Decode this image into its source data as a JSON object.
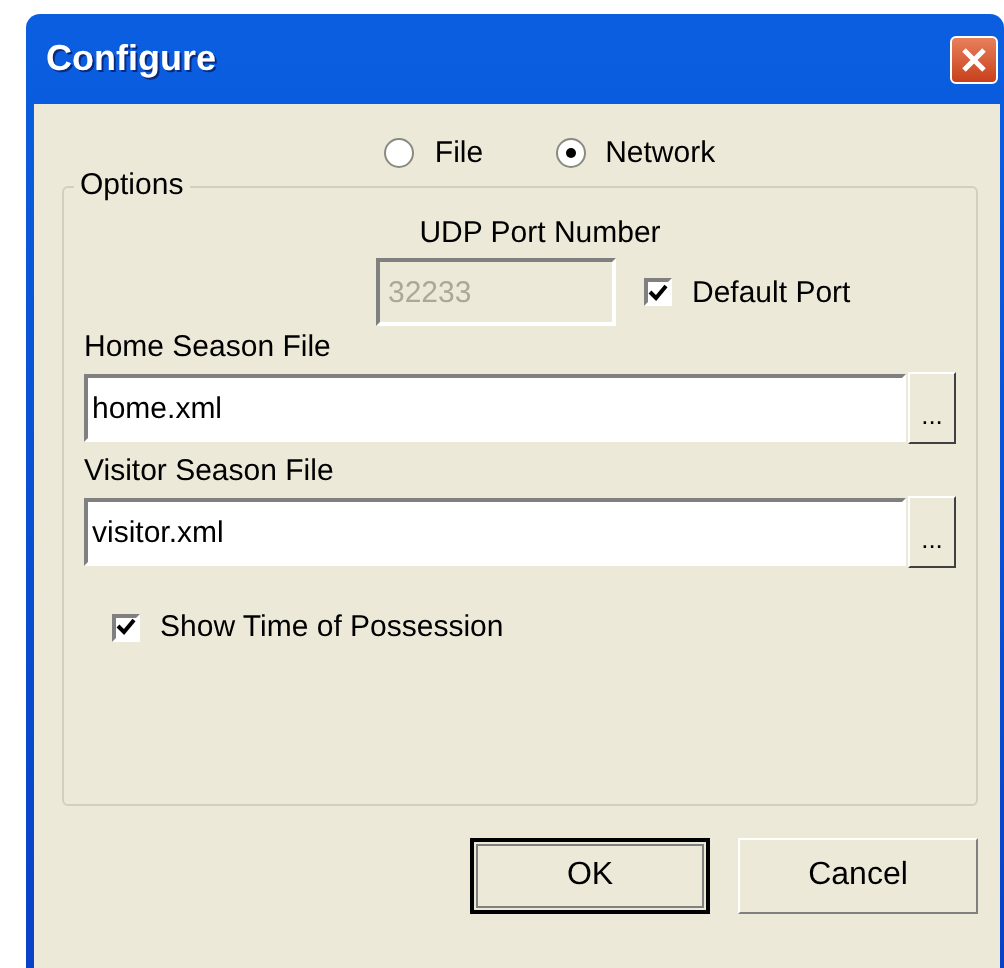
{
  "window": {
    "title": "Configure"
  },
  "mode": [
    {
      "label": "File",
      "selected": false
    },
    {
      "label": "Network",
      "selected": true
    }
  ],
  "options": {
    "title": "Options",
    "udp_port": {
      "label": "UDP Port Number",
      "value": "32233",
      "disabled": true
    },
    "default_port": {
      "label": "Default Port",
      "checked": true
    },
    "files": [
      {
        "label": "Home Season File",
        "value": "home.xml",
        "browse": "..."
      },
      {
        "label": "Visitor Season File",
        "value": "visitor.xml",
        "browse": "..."
      }
    ],
    "show_time": {
      "label": "Show Time of Possession",
      "checked": true
    }
  },
  "buttons": [
    {
      "label": "OK",
      "default": true
    },
    {
      "label": "Cancel",
      "default": false
    }
  ]
}
